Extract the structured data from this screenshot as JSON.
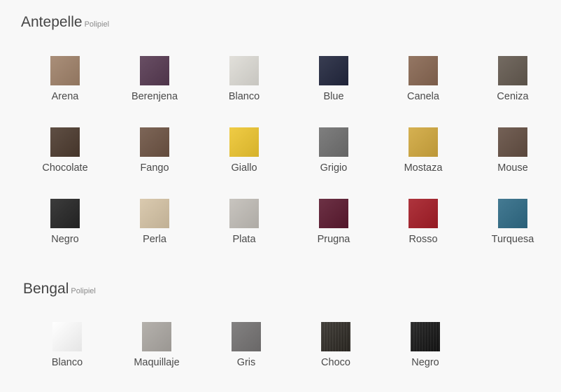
{
  "sections": [
    {
      "title": "Antepelle",
      "subtitle": "Polipiel",
      "swatches": [
        {
          "label": "Arena",
          "color": "#a0826a"
        },
        {
          "label": "Berenjena",
          "color": "#573a52"
        },
        {
          "label": "Blanco",
          "color": "#dedcd6"
        },
        {
          "label": "Blue",
          "color": "#22273e"
        },
        {
          "label": "Canela",
          "color": "#886752"
        },
        {
          "label": "Ceniza",
          "color": "#645a50"
        },
        {
          "label": "Chocolate",
          "color": "#4d3b2f"
        },
        {
          "label": "Fango",
          "color": "#6e5444"
        },
        {
          "label": "Giallo",
          "color": "#eec630"
        },
        {
          "label": "Grigio",
          "color": "#707070"
        },
        {
          "label": "Mostaza",
          "color": "#d1a83e"
        },
        {
          "label": "Mouse",
          "color": "#644f43"
        },
        {
          "label": "Negro",
          "color": "#262626"
        },
        {
          "label": "Perla",
          "color": "#d6c4a6"
        },
        {
          "label": "Plata",
          "color": "#c2beb8"
        },
        {
          "label": "Prugna",
          "color": "#5c1a30"
        },
        {
          "label": "Rosso",
          "color": "#a51d27"
        },
        {
          "label": "Turquesa",
          "color": "#2f6b86"
        }
      ]
    },
    {
      "title": "Bengal",
      "subtitle": "Polipiel",
      "swatches": [
        {
          "label": "Blanco",
          "color": "#ffffff"
        },
        {
          "label": "Maquillaje",
          "color": "#aca8a3"
        },
        {
          "label": "Gris",
          "color": "#757373"
        },
        {
          "label": "Choco",
          "color": "#2e2a24"
        },
        {
          "label": "Negro",
          "color": "#141414"
        }
      ]
    }
  ]
}
